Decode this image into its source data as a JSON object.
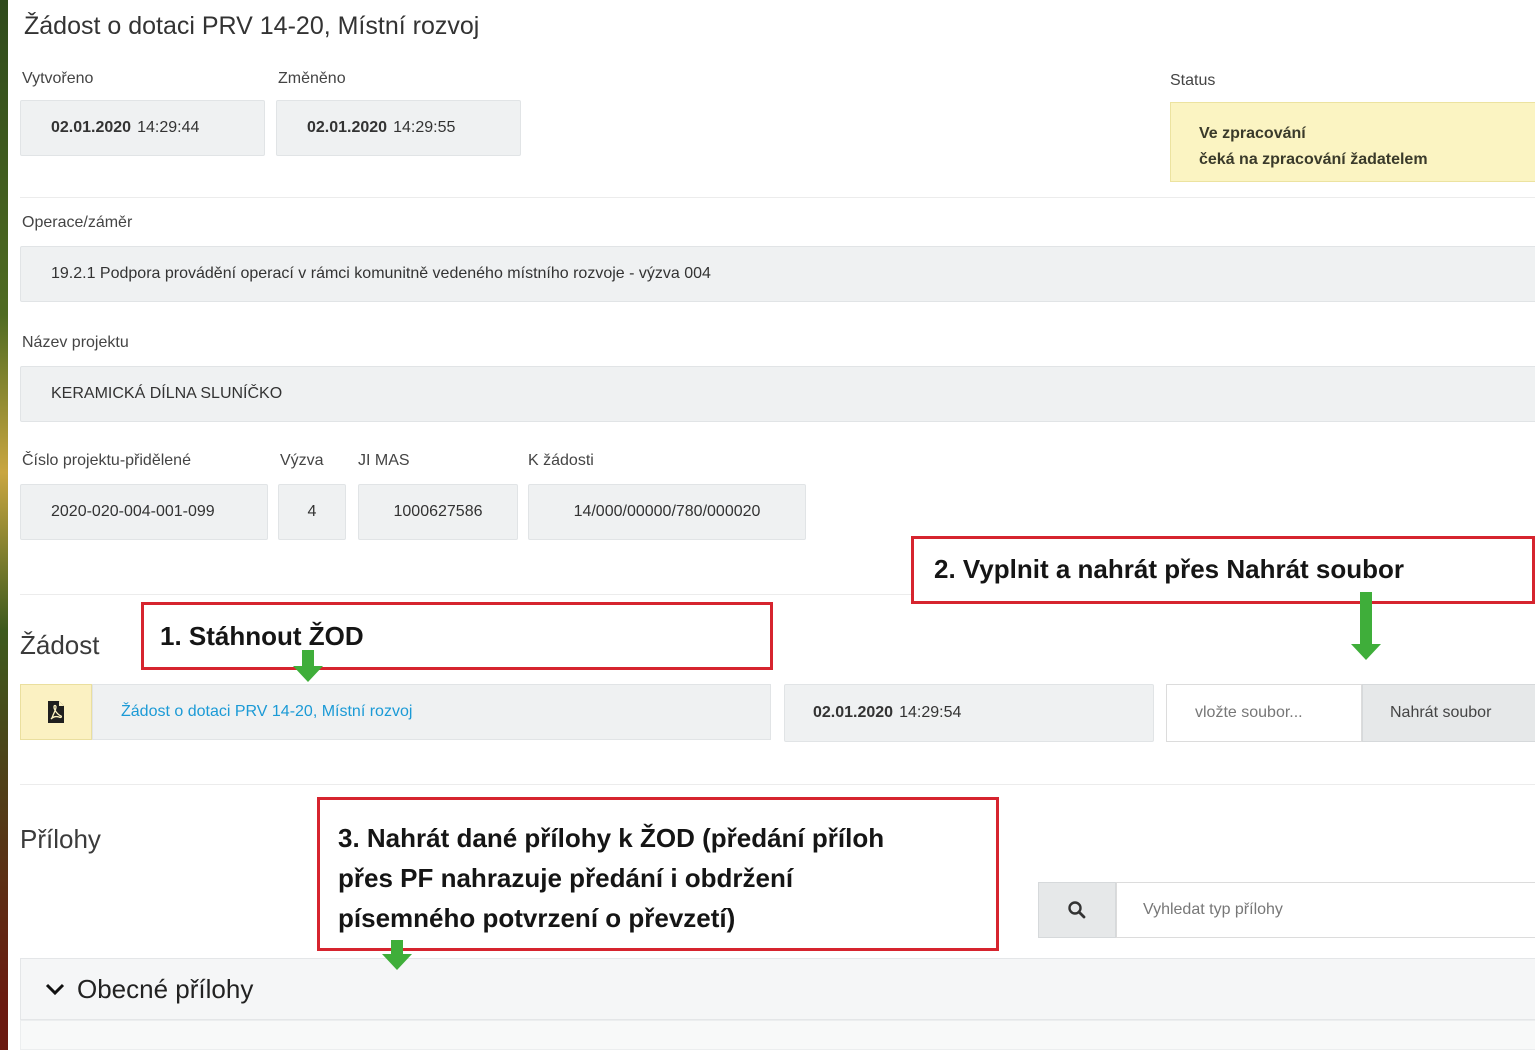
{
  "header": {
    "title": "Žádost o dotaci PRV 14-20, Místní rozvoj"
  },
  "meta": {
    "created_label": "Vytvořeno",
    "created_date": "02.01.2020",
    "created_time": "14:29:44",
    "changed_label": "Změněno",
    "changed_date": "02.01.2020",
    "changed_time": "14:29:55",
    "status_label": "Status",
    "status_line1": "Ve zpracování",
    "status_line2": "čeká na zpracování žadatelem"
  },
  "operation": {
    "label": "Operace/záměr",
    "value": "19.2.1 Podpora provádění operací v rámci komunitně vedeného místního rozvoje - výzva 004"
  },
  "project": {
    "label": "Název projektu",
    "value": "KERAMICKÁ DÍLNA SLUNÍČKO"
  },
  "ids": {
    "number_label": "Číslo projektu-přidělené",
    "number_value": "2020-020-004-001-099",
    "call_label": "Výzva",
    "call_value": "4",
    "ji_label": "JI MAS",
    "ji_value": "1000627586",
    "request_label": "K žádosti",
    "request_value": "14/000/00000/780/000020"
  },
  "request_section": {
    "title": "Žádost",
    "file_icon": "pdf-file-icon",
    "document_link": "Žádost o dotaci PRV 14-20, Místní rozvoj",
    "document_date": "02.01.2020",
    "document_time": "14:29:54",
    "file_placeholder": "vložte soubor...",
    "upload_label": "Nahrát soubor"
  },
  "attachments": {
    "title": "Přílohy",
    "search_icon": "search-icon",
    "search_placeholder": "Vyhledat typ přílohy",
    "general_group": "Obecné přílohy",
    "chevron_icon": "chevron-down-icon"
  },
  "annotations": {
    "step1": "1. Stáhnout ŽOD",
    "step2": "2. Vyplnit a nahrát přes Nahrát soubor",
    "step3_line1": "3. Nahrát dané přílohy k ŽOD (předání příloh",
    "step3_line2": "přes PF nahrazuje předání i obdržení",
    "step3_line3": "písemného potvrzení o převzetí)",
    "border_color": "#d6242e",
    "arrow_color": "#3fae3a"
  }
}
